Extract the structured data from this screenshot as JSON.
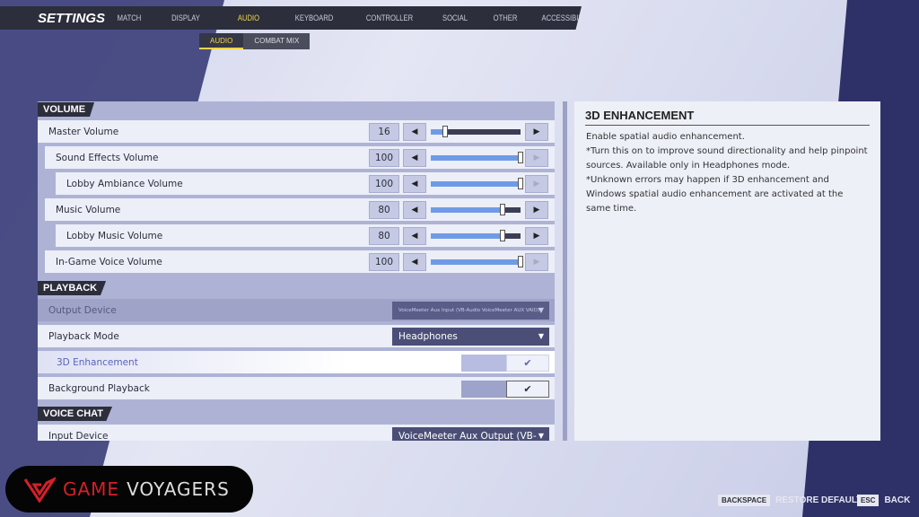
{
  "header": {
    "title": "SETTINGS",
    "tabs": [
      "MATCH",
      "DISPLAY",
      "AUDIO",
      "KEYBOARD",
      "CONTROLLER",
      "SOCIAL",
      "OTHER",
      "ACCESSIBILITY"
    ],
    "active_tab": "AUDIO"
  },
  "subtabs": [
    "AUDIO",
    "COMBAT MIX"
  ],
  "sections": {
    "volume": {
      "title": "VOLUME",
      "rows": [
        {
          "label": "Master Volume",
          "value": "16"
        },
        {
          "label": "Sound Effects Volume",
          "value": "100"
        },
        {
          "label": "Lobby Ambiance Volume",
          "value": "100"
        },
        {
          "label": "Music Volume",
          "value": "80"
        },
        {
          "label": "Lobby Music Volume",
          "value": "80"
        },
        {
          "label": "In-Game Voice Volume",
          "value": "100"
        }
      ]
    },
    "playback": {
      "title": "PLAYBACK",
      "output_device": {
        "label": "Output Device",
        "value": "VoiceMeeter Aux Input (VB-Audio VoiceMeeter AUX VAIO)"
      },
      "playback_mode": {
        "label": "Playback Mode",
        "value": "Headphones"
      },
      "enhancement": {
        "label": "3D Enhancement",
        "checked": true
      },
      "background": {
        "label": "Background Playback",
        "checked": true
      }
    },
    "voice_chat": {
      "title": "VOICE CHAT",
      "input_device": {
        "label": "Input Device",
        "value": "VoiceMeeter Aux Output (VB-Audi"
      }
    }
  },
  "info": {
    "title": "3D ENHANCEMENT",
    "text": "Enable spatial audio enhancement.\n*Turn this on to improve sound directionality and help pinpoint sources. Available only in Headphones mode.\n*Unknown errors may happen if 3D enhancement and Windows spatial audio enhancement are activated at the same time."
  },
  "footer": {
    "restore_key": "BACKSPACE",
    "restore_label": "RESTORE DEFAULTS",
    "back_key": "ESC",
    "back_label": "BACK"
  },
  "logo": {
    "part1": "GAME",
    "part2": "VOYAGERS"
  },
  "icons": {
    "check": "✔",
    "left": "◀",
    "right": "▶",
    "caret": "▼"
  },
  "colors": {
    "accent": "#f0d54a",
    "slider_fill": "#6f9be6",
    "logo_red": "#d4202a"
  }
}
